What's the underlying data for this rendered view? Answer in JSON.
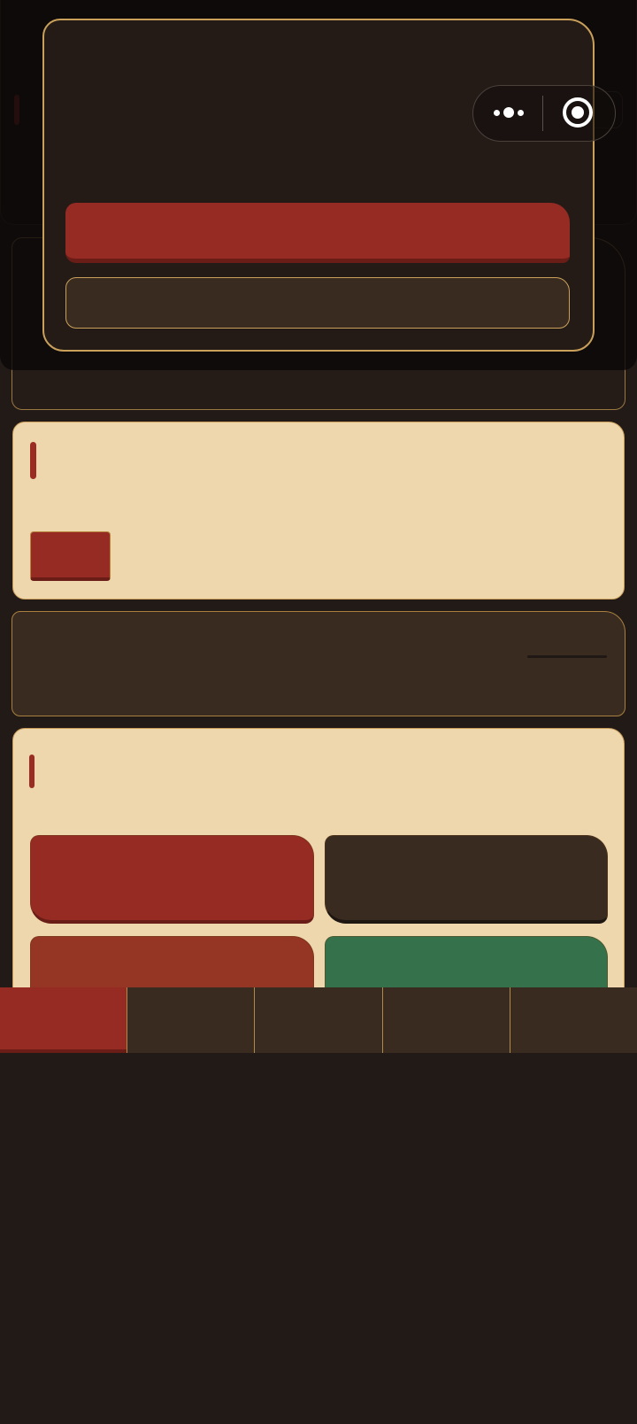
{
  "app": {
    "title": ""
  },
  "modal": {
    "title": "",
    "primary_label": "",
    "secondary_label": ""
  },
  "capsule": {
    "more_icon": "more-dots-icon",
    "close_icon": "target-close-icon"
  },
  "tabbar": {
    "tabs": [
      {
        "label": "",
        "active": true
      },
      {
        "label": "",
        "active": false
      },
      {
        "label": "",
        "active": false
      },
      {
        "label": "",
        "active": false
      },
      {
        "label": "",
        "active": false
      }
    ]
  },
  "colors": {
    "background": "#211a17",
    "cream": "#eed7ad",
    "primary_red": "#962b24",
    "dark_brown": "#3a2b21",
    "gold_border": "#c9a05a",
    "rust": "#953523",
    "green": "#35714a"
  }
}
